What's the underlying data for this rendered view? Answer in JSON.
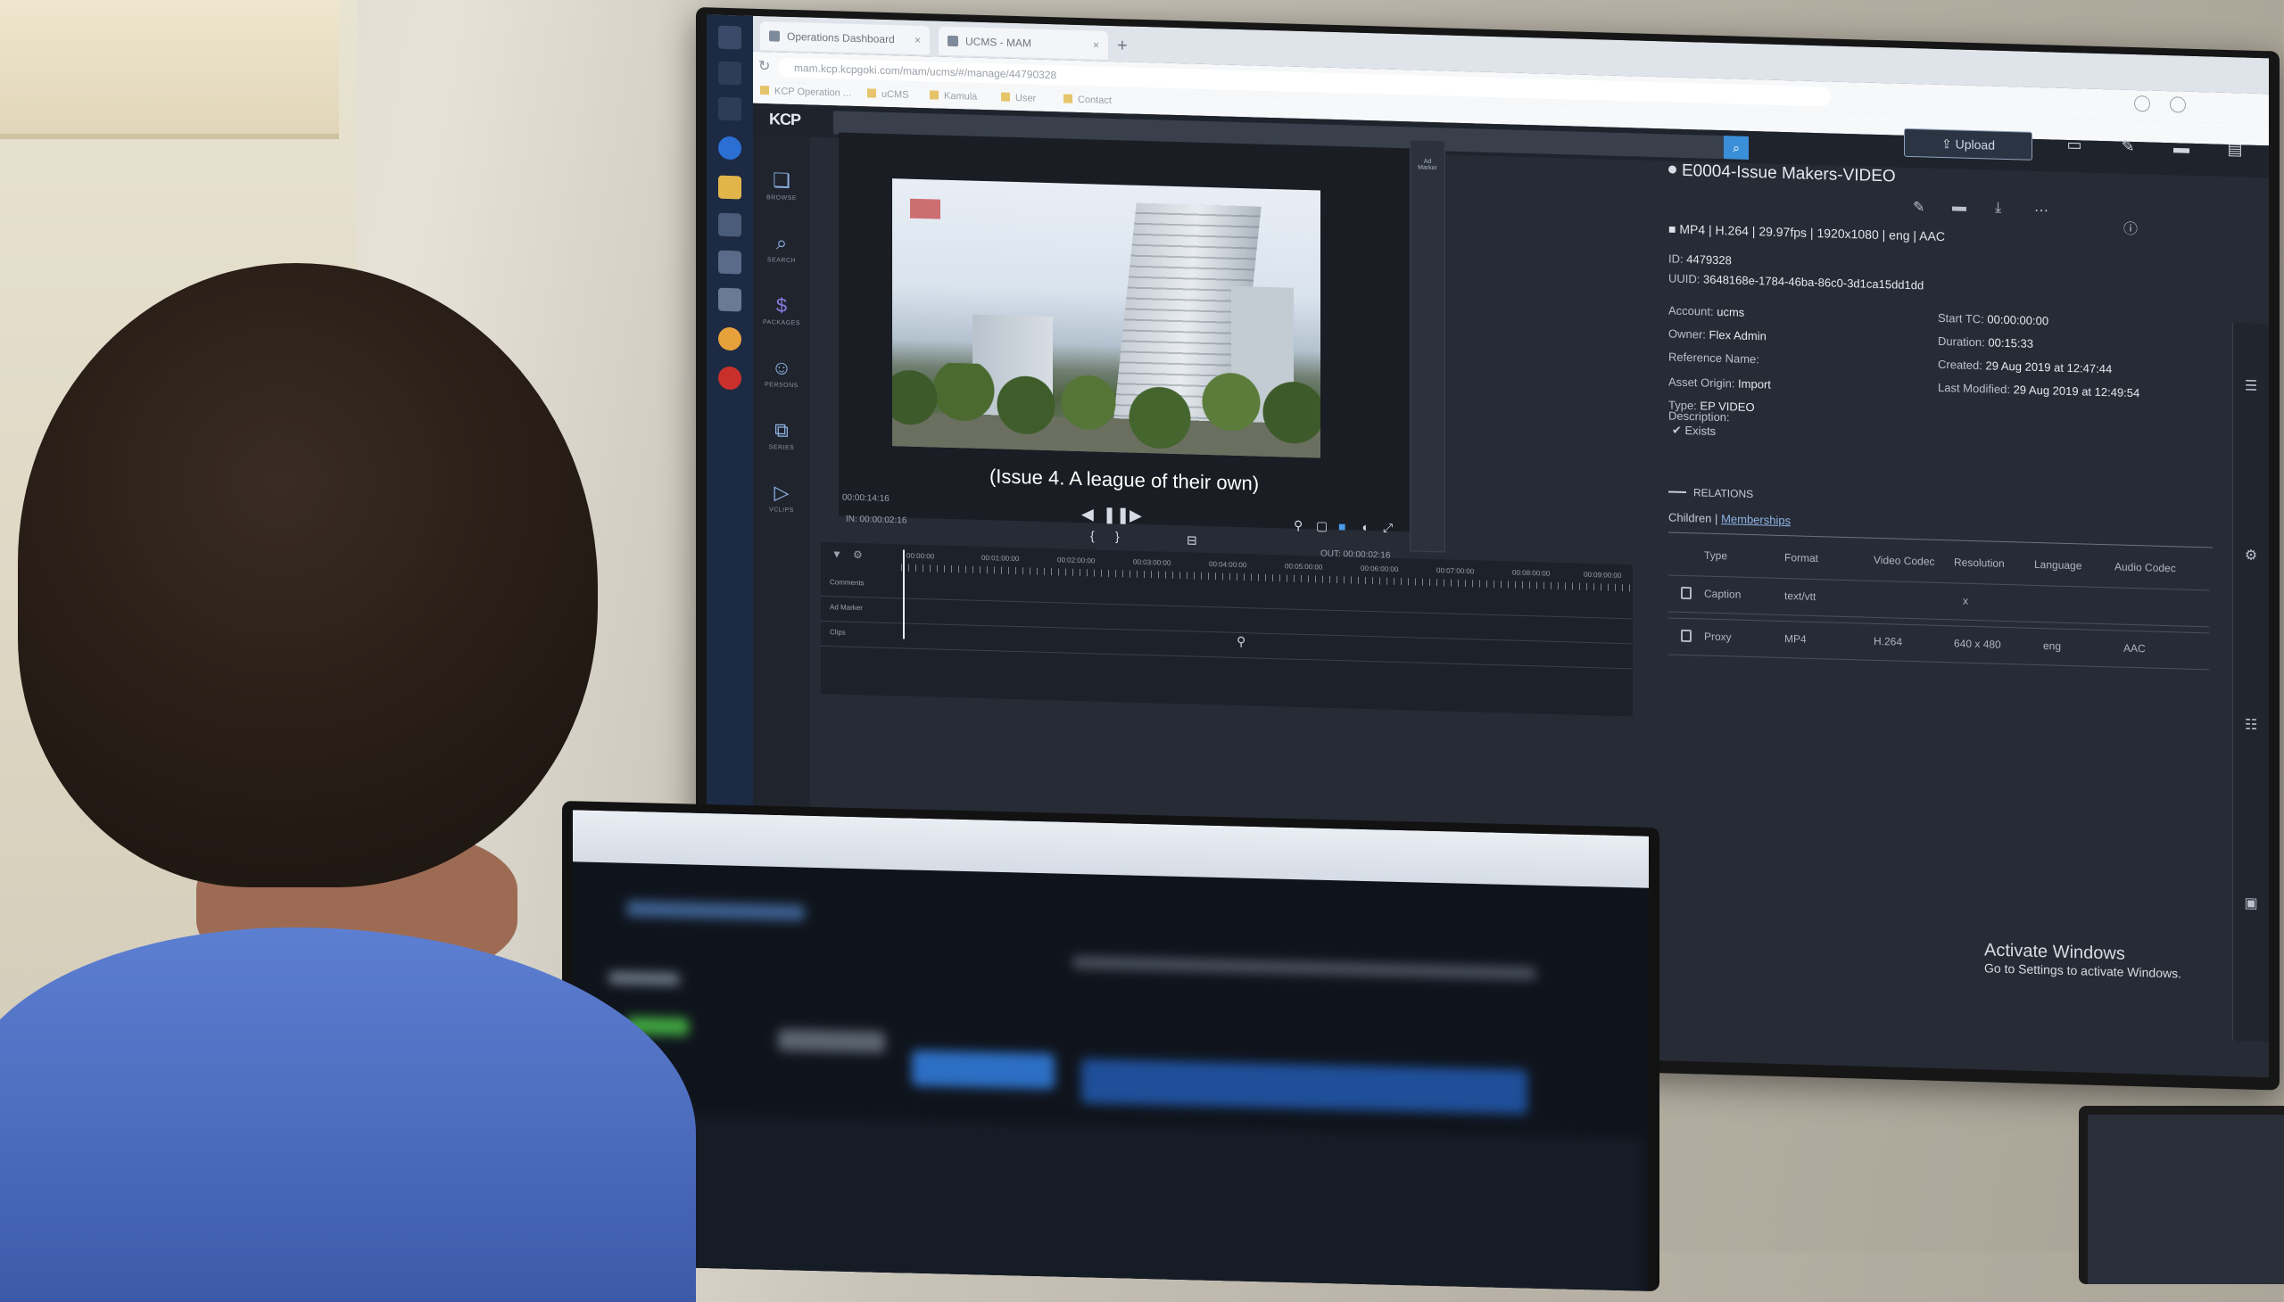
{
  "browser": {
    "tabs": [
      {
        "label": "Operations Dashboard"
      },
      {
        "label": "UCMS - MAM"
      }
    ],
    "url": "mam.kcp.kcpgoki.com/mam/ucms/#/manage/44790328",
    "bookmarks": [
      "KCP Operation ...",
      "uCMS",
      "Kamula",
      "User",
      "Contact"
    ]
  },
  "app": {
    "logo": "KCP",
    "upload_label": "Upload",
    "nav": [
      {
        "icon": "browse-icon",
        "label": "BROWSE"
      },
      {
        "icon": "search-icon",
        "label": "SEARCH"
      },
      {
        "icon": "packages-icon",
        "label": "PACKAGES"
      },
      {
        "icon": "persons-icon",
        "label": "PERSONS"
      },
      {
        "icon": "series-icon",
        "label": "SERIES"
      },
      {
        "icon": "vclips-icon",
        "label": "VCLIPS"
      }
    ]
  },
  "player": {
    "subtitle": "(Issue 4. A league of their own)",
    "current_time": "00:00:14:16",
    "in_point": "IN: 00:00:02:16",
    "out_point": "OUT: 00:00:02:16",
    "marker_label": "Ad Marker"
  },
  "timeline": {
    "ticks": [
      "00:00:00",
      "00:01:00:00",
      "00:02:00:00",
      "00:03:00:00",
      "00:04:00:00",
      "00:05:00:00",
      "00:06:00:00",
      "00:07:00:00",
      "00:08:00:00",
      "00:09:00:00"
    ],
    "rows": [
      "Comments",
      "Ad Marker",
      "Clips"
    ]
  },
  "asset": {
    "title": "E0004-Issue Makers-VIDEO",
    "format_line": "MP4 | H.264 | 29.97fps | 1920x1080 | eng | AAC",
    "id_label": "ID:",
    "id_value": "4479328",
    "uuid_label": "UUID:",
    "uuid_value": "3648168e-1784-46ba-86c0-3d1ca15dd1dd",
    "account_label": "Account:",
    "account_value": "ucms",
    "owner_label": "Owner:",
    "owner_value": "Flex Admin",
    "reference_label": "Reference Name:",
    "origin_label": "Asset Origin:",
    "origin_value": "Import",
    "type_label": "Type:",
    "type_value": "EP VIDEO",
    "start_tc_label": "Start TC:",
    "start_tc_value": "00:00:00:00",
    "duration_label": "Duration:",
    "duration_value": "00:15:33",
    "created_label": "Created:",
    "created_value": "29 Aug 2019 at 12:47:44",
    "modified_label": "Last Modified:",
    "modified_value": "29 Aug 2019 at 12:49:54",
    "description_label": "Description:",
    "exists_label": "Exists"
  },
  "relations": {
    "title": "RELATIONS",
    "tab_children": "Children",
    "separator": "|",
    "tab_memberships": "Memberships",
    "columns": [
      "Type",
      "Format",
      "Video Codec",
      "Resolution",
      "Language",
      "Audio Codec"
    ],
    "rows": [
      {
        "type": "Caption",
        "format": "text/vtt",
        "video_codec": "",
        "resolution": "x",
        "language": "",
        "audio_codec": ""
      },
      {
        "type": "Proxy",
        "format": "MP4",
        "video_codec": "H.264",
        "resolution": "640 x 480",
        "language": "eng",
        "audio_codec": "AAC"
      }
    ]
  },
  "windows": {
    "activate_title": "Activate Windows",
    "activate_sub": "Go to Settings to activate Windows."
  }
}
